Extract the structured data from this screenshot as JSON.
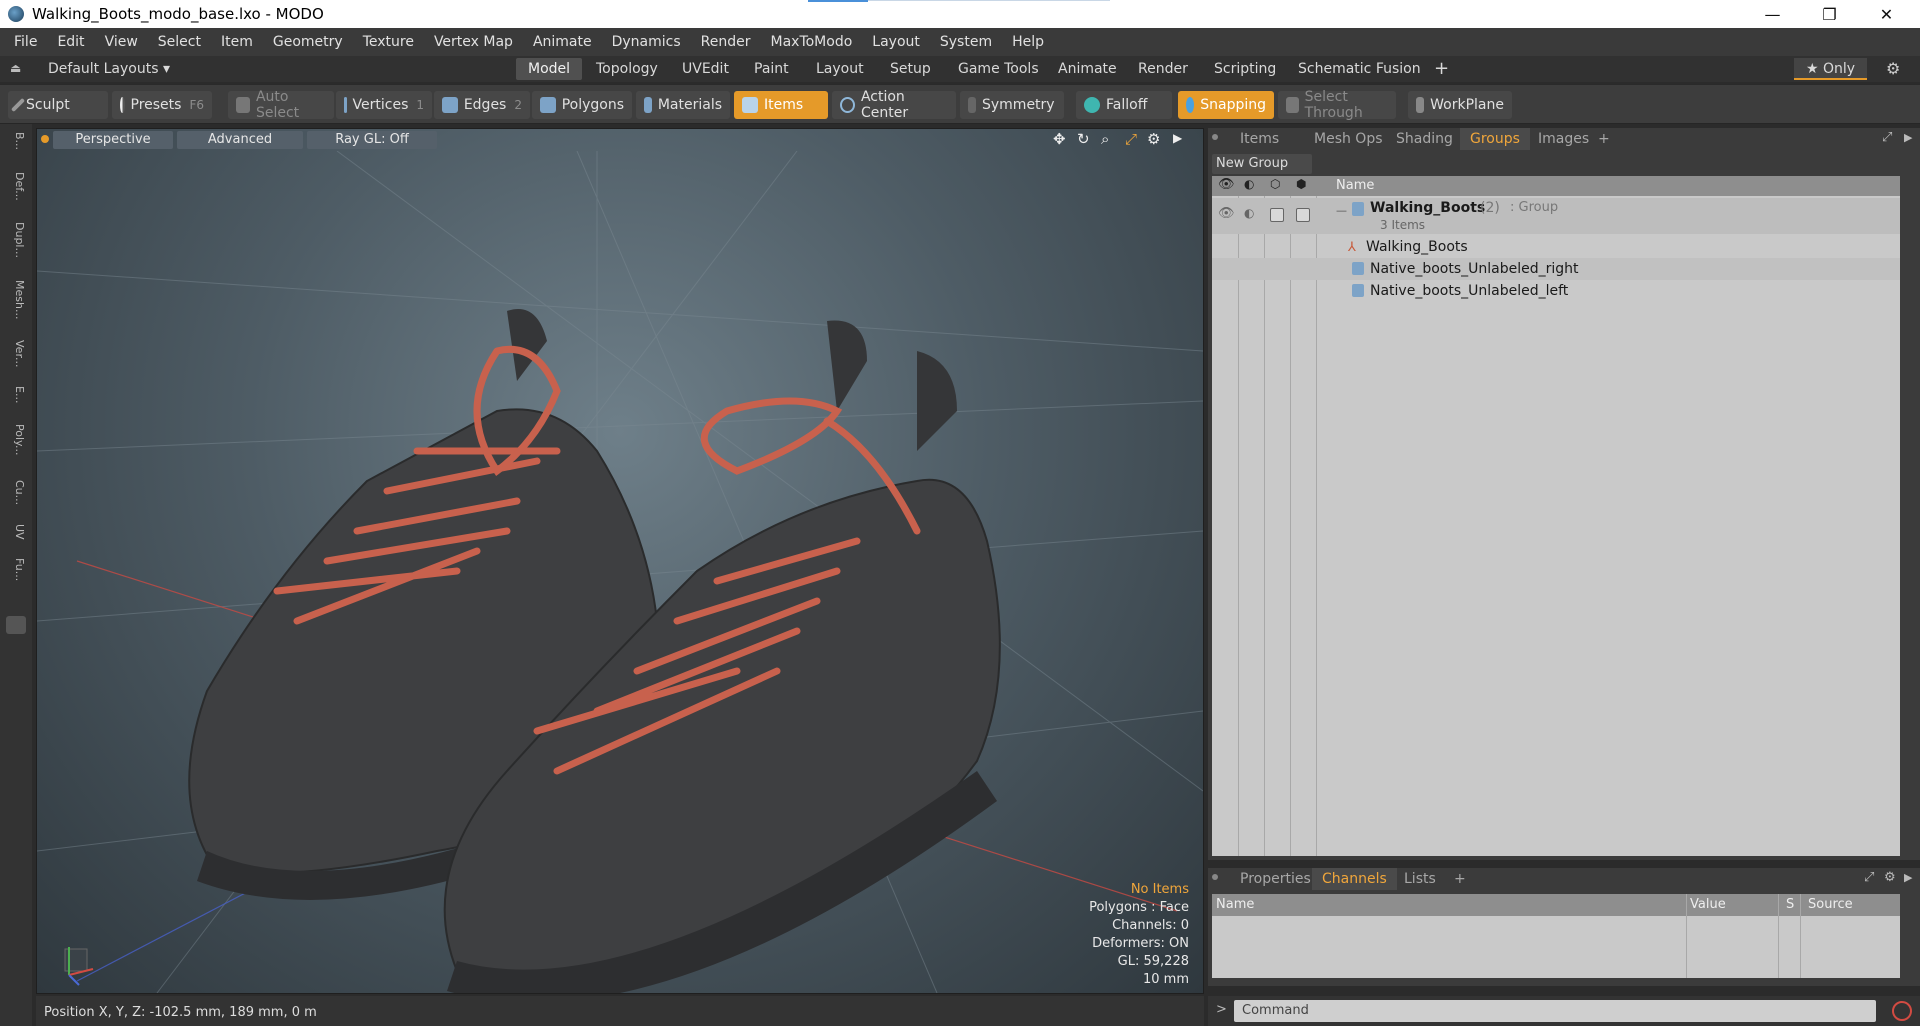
{
  "window": {
    "title": "Walking_Boots_modo_base.lxo - MODO",
    "minimize": "—",
    "restore": "❐",
    "close": "✕"
  },
  "menu": [
    "File",
    "Edit",
    "View",
    "Select",
    "Item",
    "Geometry",
    "Texture",
    "Vertex Map",
    "Animate",
    "Dynamics",
    "Render",
    "MaxToModo",
    "Layout",
    "System",
    "Help"
  ],
  "layout": {
    "preset": "Default Layouts ▾",
    "tabs": [
      "Model",
      "Topology",
      "UVEdit",
      "Paint",
      "Layout",
      "Setup",
      "Game Tools",
      "Animate",
      "Render",
      "Scripting",
      "Schematic Fusion"
    ],
    "active_tab": "Model",
    "add": "+",
    "only": "★  Only"
  },
  "toolbar": {
    "sculpt": "Sculpt",
    "presets": "Presets",
    "presets_key": "F6",
    "auto_select": "Auto Select",
    "vertices": "Vertices",
    "vertices_count": "1",
    "edges": "Edges",
    "edges_count": "2",
    "polygons": "Polygons",
    "materials": "Materials",
    "items": "Items",
    "action_center": "Action Center",
    "symmetry": "Symmetry",
    "falloff": "Falloff",
    "snapping": "Snapping",
    "select_through": "Select Through",
    "workplane": "WorkPlane"
  },
  "left_strip": [
    "B...",
    "Def...",
    "Dupl...",
    "Mesh...",
    "Ver...",
    "E...",
    "Poly...",
    "Cu...",
    "UV",
    "Fu..."
  ],
  "viewport": {
    "view": "Perspective",
    "advanced": "Advanced",
    "raygl": "Ray GL: Off",
    "stats": {
      "no_items": "No Items",
      "polygons": "Polygons : Face",
      "channels": "Channels: 0",
      "deformers": "Deformers: ON",
      "gl": "GL: 59,228",
      "scale": "10 mm"
    }
  },
  "status": {
    "position": "Position X, Y, Z:   -102.5 mm, 189 mm, 0 m"
  },
  "right_panel": {
    "tabs": [
      "Items",
      "Mesh Ops",
      "Shading",
      "Groups",
      "Images"
    ],
    "active_tab": "Groups",
    "add": "+",
    "new_group": "New Group",
    "header_name": "Name",
    "group": {
      "name": "Walking_Boots",
      "count": "(2)",
      "type": ": Group",
      "subtitle": "3 Items"
    },
    "children": [
      "Walking_Boots",
      "Native_boots_Unlabeled_right",
      "Native_boots_Unlabeled_left"
    ]
  },
  "channels_panel": {
    "tabs": [
      "Properties",
      "Channels",
      "Lists"
    ],
    "active_tab": "Channels",
    "add": "+",
    "columns": [
      "Name",
      "Value",
      "S",
      "Source"
    ]
  },
  "command": {
    "placeholder": "Command"
  },
  "colors": {
    "accent": "#e59a29",
    "active_text": "#f0a63b",
    "lace": "#c8614d",
    "boot": "#3e3f41"
  }
}
